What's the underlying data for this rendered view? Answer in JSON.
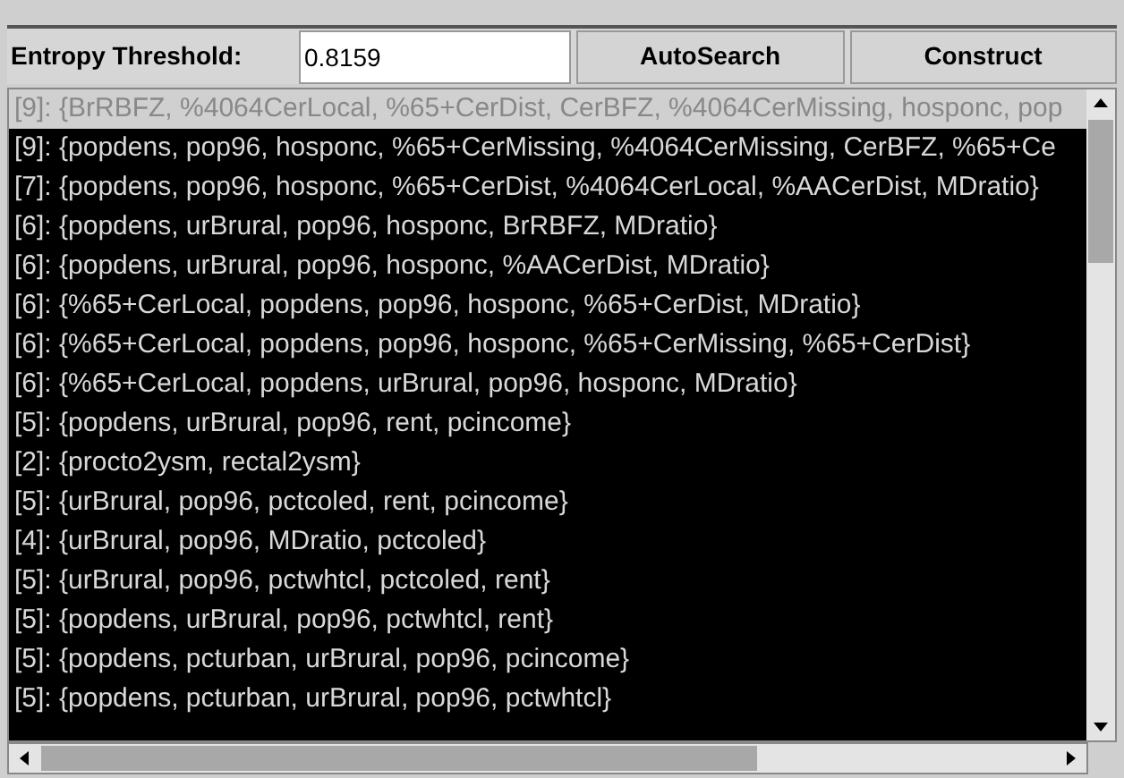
{
  "toolbar": {
    "threshold_label": "Entropy Threshold:",
    "threshold_value": "0.8159",
    "buttons": [
      "AutoSearch",
      "Construct"
    ]
  },
  "results": [
    {
      "text": "[9]: {BrRBFZ, %4064CerLocal, %65+CerDist, CerBFZ, %4064CerMissing, hosponc, pop",
      "selected": true
    },
    {
      "text": "[9]: {popdens, pop96, hosponc, %65+CerMissing, %4064CerMissing, CerBFZ, %65+Ce",
      "selected": false
    },
    {
      "text": "[7]: {popdens, pop96, hosponc, %65+CerDist, %4064CerLocal, %AACerDist, MDratio}",
      "selected": false
    },
    {
      "text": "[6]: {popdens, urBrural, pop96, hosponc, BrRBFZ, MDratio}",
      "selected": false
    },
    {
      "text": "[6]: {popdens, urBrural, pop96, hosponc, %AACerDist, MDratio}",
      "selected": false
    },
    {
      "text": "[6]: {%65+CerLocal, popdens, pop96, hosponc, %65+CerDist, MDratio}",
      "selected": false
    },
    {
      "text": "[6]: {%65+CerLocal, popdens, pop96, hosponc, %65+CerMissing, %65+CerDist}",
      "selected": false
    },
    {
      "text": "[6]: {%65+CerLocal, popdens, urBrural, pop96, hosponc, MDratio}",
      "selected": false
    },
    {
      "text": "[5]: {popdens, urBrural, pop96, rent, pcincome}",
      "selected": false
    },
    {
      "text": "[2]: {procto2ysm, rectal2ysm}",
      "selected": false
    },
    {
      "text": "[5]: {urBrural, pop96, pctcoled, rent, pcincome}",
      "selected": false
    },
    {
      "text": "[4]: {urBrural, pop96, MDratio, pctcoled}",
      "selected": false
    },
    {
      "text": "[5]: {urBrural, pop96, pctwhtcl, pctcoled, rent}",
      "selected": false
    },
    {
      "text": "[5]: {popdens, urBrural, pop96, pctwhtcl, rent}",
      "selected": false
    },
    {
      "text": "[5]: {popdens, pcturban, urBrural, pop96, pcincome}",
      "selected": false
    },
    {
      "text": "[5]: {popdens, pcturban, urBrural, pop96, pctwhtcl}",
      "selected": false
    }
  ]
}
